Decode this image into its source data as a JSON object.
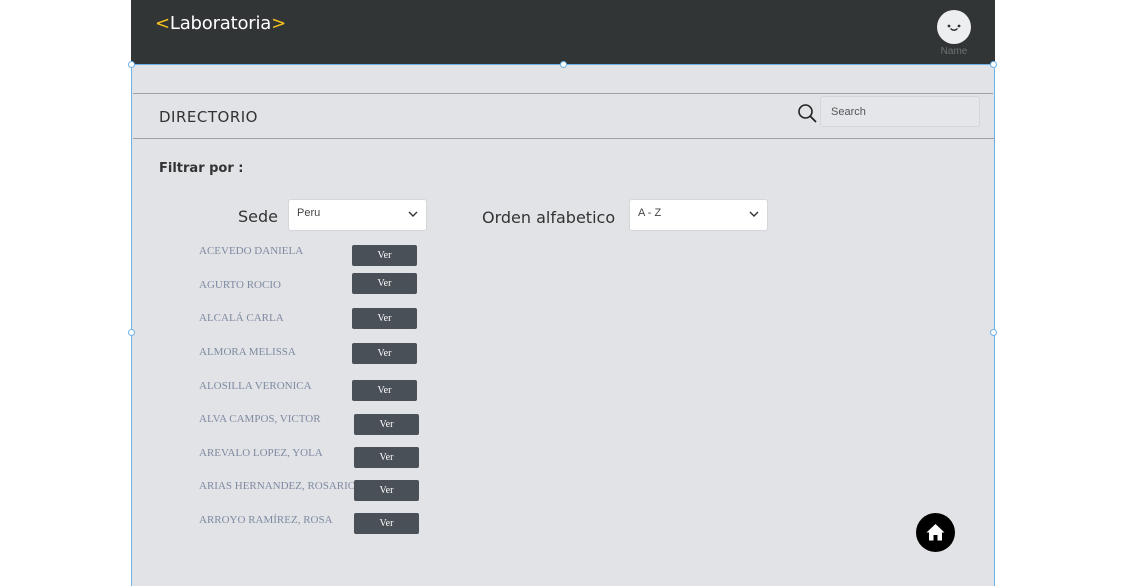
{
  "header": {
    "logo_text": "Laboratoria",
    "logo_bracket_left": "<",
    "logo_bracket_right": ">",
    "avatar_name": "Name",
    "logo_color": "#ffffff",
    "bracket_color": "#f7c31d",
    "bar_color": "#323536"
  },
  "page": {
    "title": "DIRECTORIO",
    "search_placeholder": "Search",
    "filter_label": "Filtrar por :"
  },
  "filters": {
    "sede_label": "Sede",
    "sede_value": "Peru",
    "orden_label": "Orden alfabetico",
    "orden_value": "A - Z"
  },
  "students": [
    {
      "name": "ACEVEDO  DANIELA",
      "button": "Ver"
    },
    {
      "name": "AGURTO  ROCIO",
      "button": "Ver"
    },
    {
      "name": "ALCALÁ   CARLA",
      "button": "Ver"
    },
    {
      "name": "ALMORA MELISSA",
      "button": "Ver"
    },
    {
      "name": "ALOSILLA VERONICA",
      "button": "Ver"
    },
    {
      "name": "ALVA CAMPOS, VICTOR",
      "button": "Ver"
    },
    {
      "name": "AREVALO LOPEZ, YOLA",
      "button": "Ver"
    },
    {
      "name": "ARIAS HERNANDEZ, ROSARIO",
      "button": "Ver"
    },
    {
      "name": "ARROYO RAMÍREZ, ROSA",
      "button": "Ver"
    }
  ],
  "icons": {
    "search": "search-icon",
    "chevron": "chevron-down-icon",
    "home": "home-icon",
    "avatar": "smiley-face-icon"
  }
}
